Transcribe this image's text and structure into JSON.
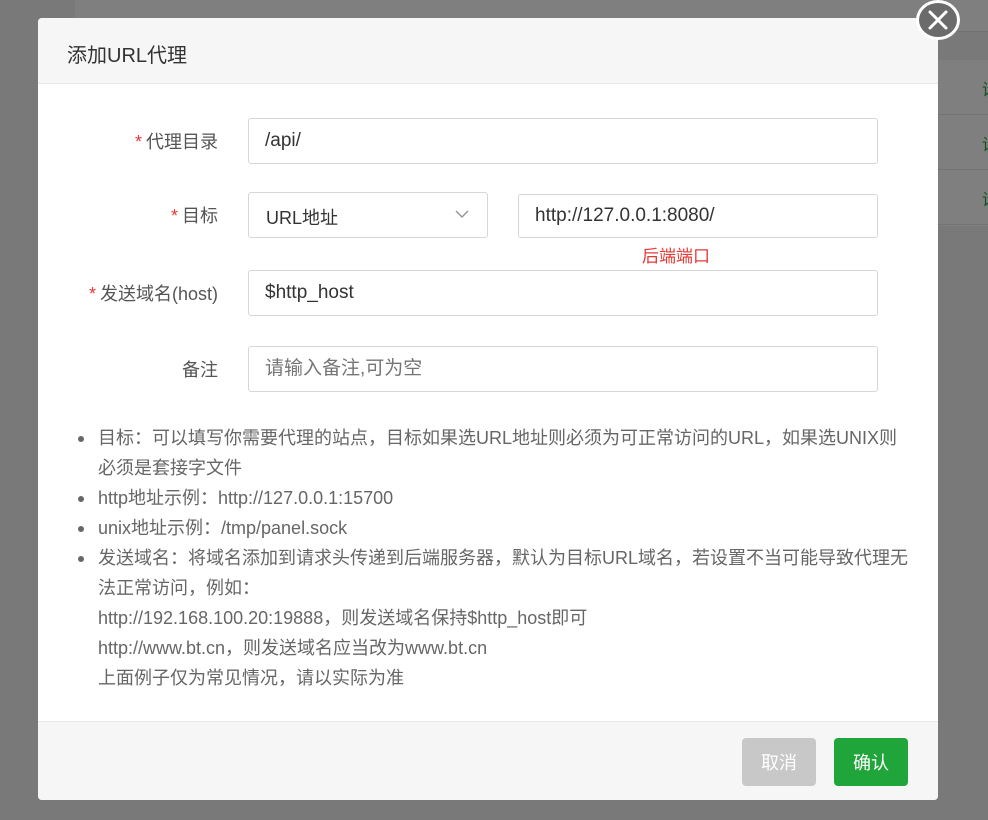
{
  "background": {
    "link_label": "设"
  },
  "dialog": {
    "title": "添加URL代理",
    "close_icon": "close-icon"
  },
  "form": {
    "proxy_dir": {
      "label": "代理目录",
      "required": "*",
      "value": "/api/"
    },
    "target": {
      "label": "目标",
      "required": "*",
      "type_selected": "URL地址",
      "url_value": "http://127.0.0.1:8080/",
      "hint": "后端端口"
    },
    "host": {
      "label": "发送域名(host)",
      "required": "*",
      "value": "$http_host"
    },
    "remark": {
      "label": "备注",
      "placeholder": "请输入备注,可为空"
    }
  },
  "help": {
    "item1": {
      "line1": "目标：可以填写你需要代理的站点，目标如果选URL地址则必须为可正常访问的URL，如果选UNIX则",
      "line2": "必须是套接字文件"
    },
    "item2": "http地址示例：http://127.0.0.1:15700",
    "item3": "unix地址示例：/tmp/panel.sock",
    "item4": {
      "line1": "发送域名：将域名添加到请求头传递到后端服务器，默认为目标URL域名，若设置不当可能导致代理无",
      "line2": "法正常访问，例如：",
      "line3": "http://192.168.100.20:19888，则发送域名保持$http_host即可",
      "line4": "http://www.bt.cn，则发送域名应当改为www.bt.cn",
      "line5": "上面例子仅为常见情况，请以实际为准"
    }
  },
  "footer": {
    "cancel_label": "取消",
    "ok_label": "确认"
  },
  "colors": {
    "accent": "#20a53a",
    "required": "#e53935",
    "cancel": "#c8c8c8"
  }
}
